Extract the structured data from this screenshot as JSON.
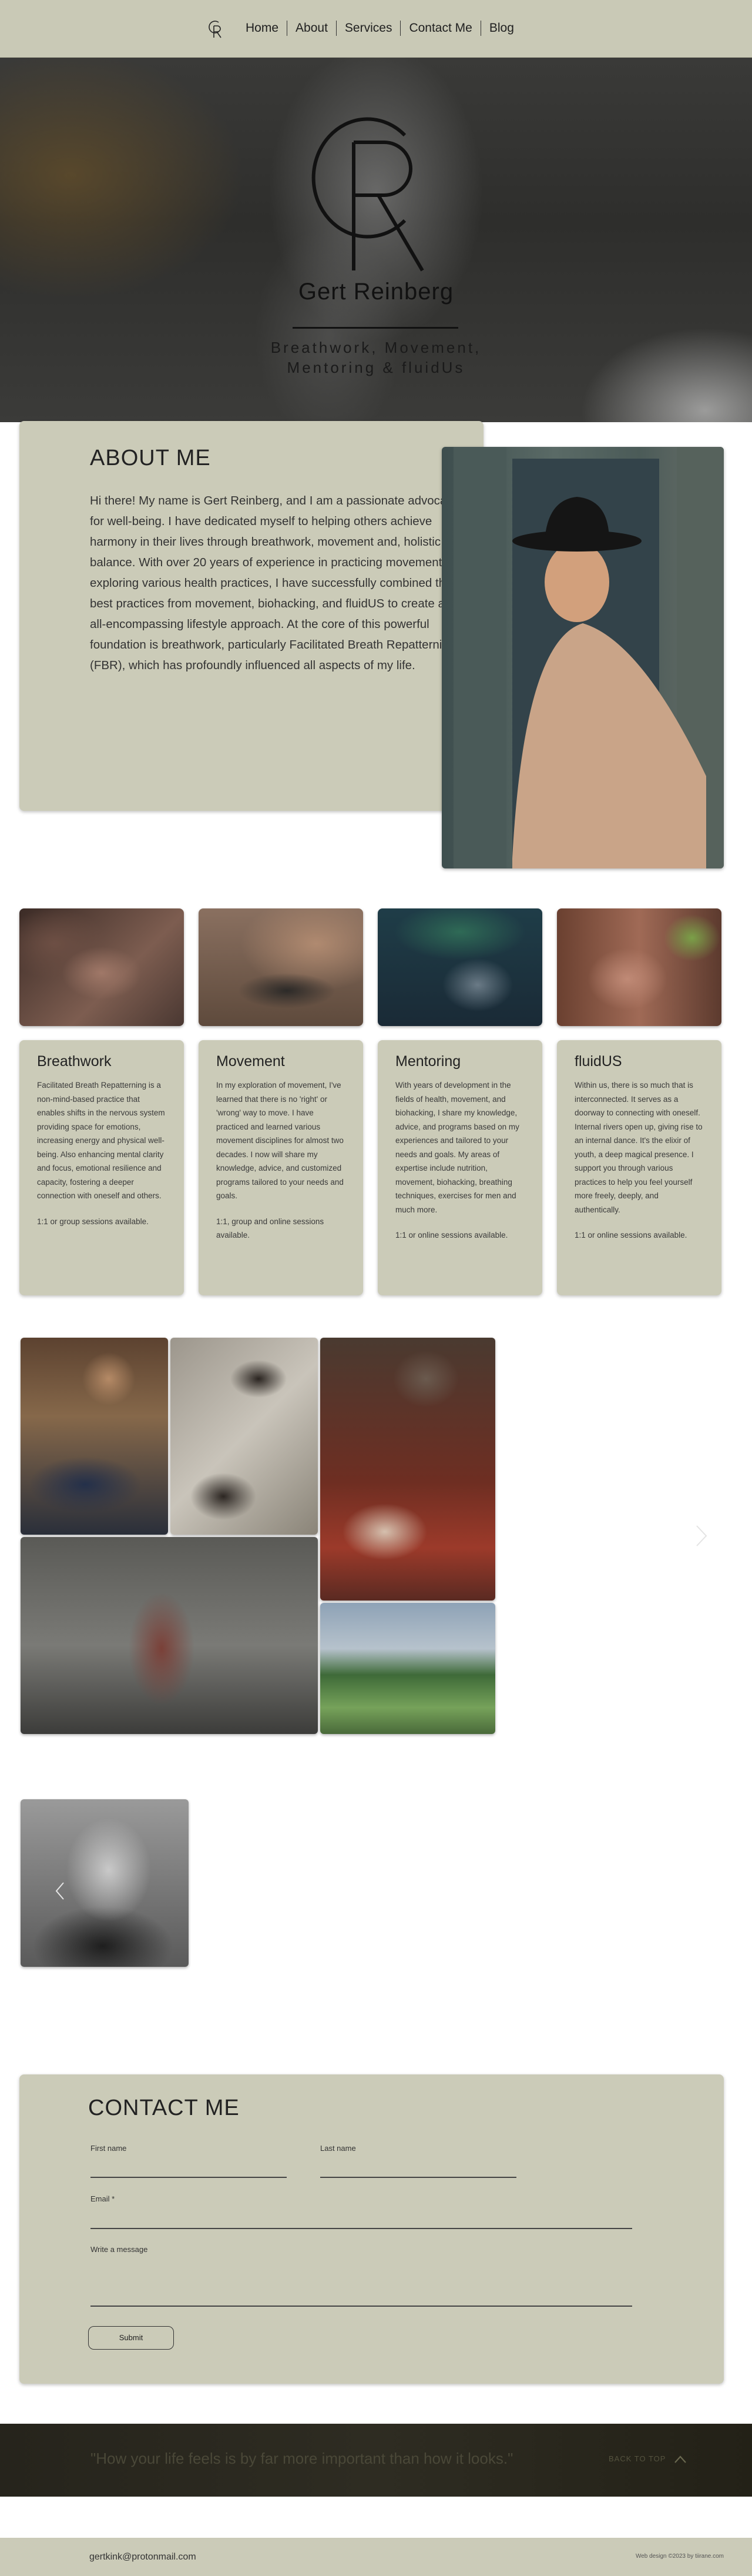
{
  "nav": {
    "logo_icon": "gr-monogram-icon",
    "links": [
      "Home",
      "About",
      "Services",
      "Contact Me",
      "Blog"
    ]
  },
  "hero": {
    "name": "Gert Reinberg",
    "subtitle_line1": "Breathwork, Movement,",
    "subtitle_line2": "Mentoring & fluidUs"
  },
  "about": {
    "title": "ABOUT ME",
    "text": "Hi there! My name is Gert Reinberg, and I am a passionate advocate for well-being. I have dedicated myself to helping others achieve harmony in their lives through breathwork, movement and, holistic balance. With over 20 years of experience in practicing movement and exploring various health practices, I have successfully combined the best practices from movement, biohacking, and fluidUS to create an all-encompassing lifestyle approach. At the core of this powerful foundation is breathwork, particularly Facilitated Breath Repatterning (FBR), which has profoundly influenced all aspects of my life."
  },
  "services": [
    {
      "title": "Breathwork",
      "text": "Facilitated Breath Repatterning is a non-mind-based practice that enables shifts in the nervous system providing space for emotions, increasing energy and physical well-being. Also enhancing mental clarity and focus, emotional resilience and capacity, fostering a deeper connection with oneself and others.",
      "footer": "1:1 or group sessions available."
    },
    {
      "title": "Movement",
      "text": "In my exploration of movement, I've learned that there is no 'right' or 'wrong' way to move. I have practiced and learned various movement disciplines for almost two decades. I now will share my knowledge, advice, and customized programs tailored to your needs and goals.",
      "footer": "1:1, group and online sessions available."
    },
    {
      "title": "Mentoring",
      "text": "With years of development in the fields of health, movement, and biohacking, I share my knowledge, advice, and programs based on my experiences and tailored to your needs and goals. My areas of expertise include nutrition, movement, biohacking, breathing techniques, exercises for men and much more.",
      "footer": "1:1 or online sessions available."
    },
    {
      "title": "fluidUS",
      "text": "Within us, there is so much that is interconnected. It serves as a doorway to connecting with oneself. Internal rivers open up, giving rise to an internal dance. It's the elixir of youth, a deep magical presence. I support you through various practices to help you feel yourself more freely, deeply, and authentically.",
      "footer": "1:1 or online sessions available."
    }
  ],
  "gallery": {
    "next_icon": "chevron-right-icon",
    "prev_icon": "chevron-left-icon"
  },
  "contact": {
    "title": "CONTACT ME",
    "first_name_label": "First name",
    "last_name_label": "Last name",
    "email_label": "Email *",
    "message_label": "Write a message",
    "submit_label": "Submit"
  },
  "quote": {
    "text": "\"How your life feels is by far more important than how it looks.\"",
    "back_to_top": "BACK TO TOP",
    "back_icon": "chevron-up-icon"
  },
  "footer": {
    "email": "gertkink@protonmail.com",
    "credit": "Web design ©2023 by tiirane.com"
  }
}
